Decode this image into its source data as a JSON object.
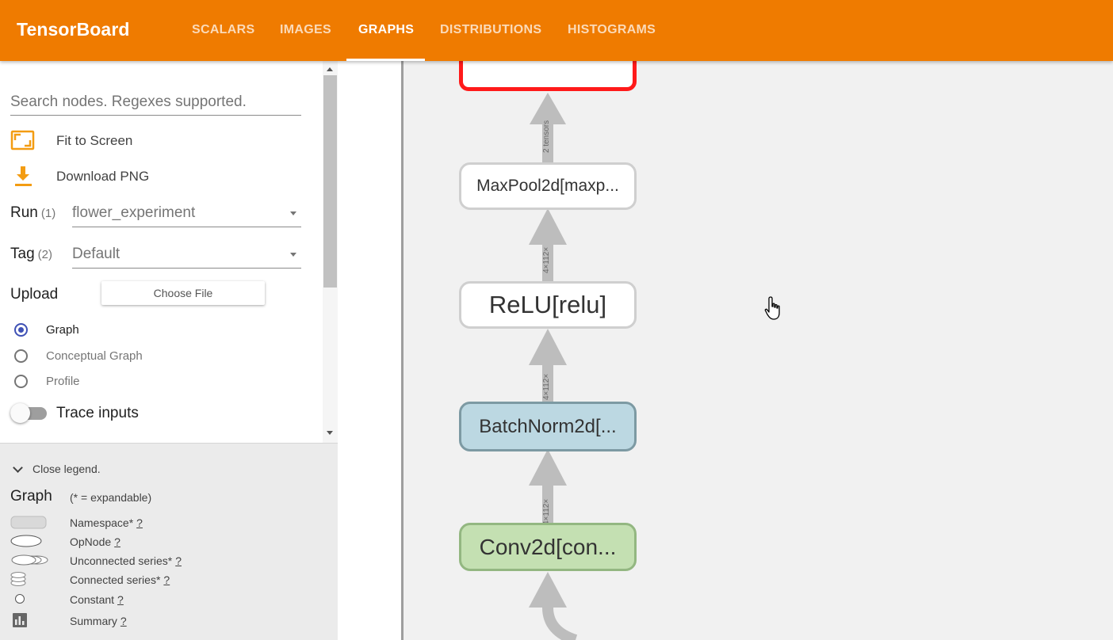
{
  "app": {
    "brand": "TensorBoard",
    "tabs": [
      "SCALARS",
      "IMAGES",
      "GRAPHS",
      "DISTRIBUTIONS",
      "HISTOGRAMS"
    ],
    "active_tab": "GRAPHS"
  },
  "sidebar": {
    "search_placeholder": "Search nodes. Regexes supported.",
    "fit_to_screen": "Fit to Screen",
    "download_png": "Download PNG",
    "run": {
      "label": "Run",
      "count": "(1)",
      "value": "flower_experiment"
    },
    "tag": {
      "label": "Tag",
      "count": "(2)",
      "value": "Default"
    },
    "upload": {
      "label": "Upload",
      "button": "Choose File"
    },
    "graph_types": [
      {
        "label": "Graph",
        "selected": true
      },
      {
        "label": "Conceptual Graph",
        "selected": false
      },
      {
        "label": "Profile",
        "selected": false
      }
    ],
    "trace_inputs": {
      "label": "Trace inputs",
      "enabled": false
    }
  },
  "legend": {
    "toggle": "Close legend.",
    "title": "Graph",
    "subtitle": "(* = expandable)",
    "help": "?",
    "items": [
      {
        "name": "Namespace*",
        "icon": "namespace-icon"
      },
      {
        "name": "OpNode",
        "icon": "opnode-icon"
      },
      {
        "name": "Unconnected series*",
        "icon": "unconnected-series-icon"
      },
      {
        "name": "Connected series*",
        "icon": "connected-series-icon"
      },
      {
        "name": "Constant",
        "icon": "constant-icon"
      },
      {
        "name": "Summary",
        "icon": "summary-icon"
      }
    ]
  },
  "graph": {
    "nodes": [
      {
        "label": "MaxPool2d[maxp...",
        "fill": "#ffffff",
        "stroke": "#cfcfcf"
      },
      {
        "label": "ReLU[relu]",
        "fill": "#ffffff",
        "stroke": "#cfcfcf"
      },
      {
        "label": "BatchNorm2d[...",
        "fill": "#bcd8e2",
        "stroke": "#7d9aa3"
      },
      {
        "label": "Conv2d[con...",
        "fill": "#c4e0b2",
        "stroke": "#93b781"
      }
    ],
    "edge_labels": [
      "2 tensors",
      "4×112×",
      "4×112×",
      "4×112×"
    ],
    "selected_node_stroke": "#ff1a1a"
  },
  "colors": {
    "accent": "#ef7b00",
    "selection": "#3f51b5"
  }
}
